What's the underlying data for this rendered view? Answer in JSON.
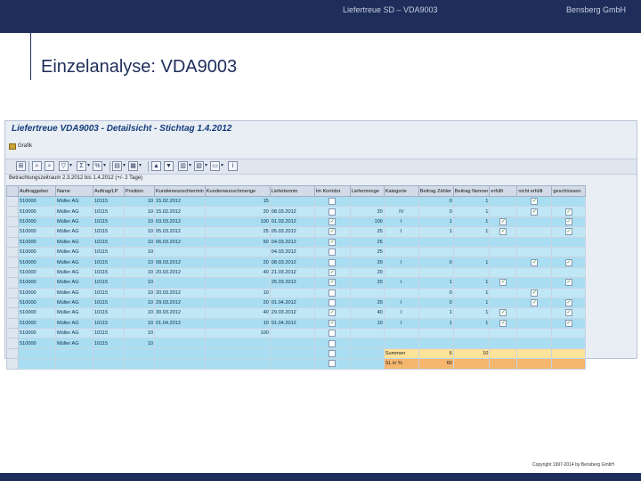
{
  "slide": {
    "header_center": "Liefertreue SD – VDA9003",
    "header_right": "Bensberg GmbH",
    "title": "Einzelanalyse: VDA9003",
    "copyright": "Copyright 1997-2014 by Bensberg GmbH"
  },
  "sap": {
    "title": "Liefertreue VDA9003 - Detailsicht - Stichtag 1.4.2012",
    "menu_button": "Grafik",
    "period_label": "Betrachtungszeitraum 2.3.2012 bis 1.4.2012 (+/- 2 Tage)",
    "toolbar_icons": [
      "details-icon",
      "find-icon",
      "filter-icon",
      "sum-icon",
      "subtotal-icon",
      "print-icon",
      "export-icon",
      "sort-asc-icon",
      "sort-desc-icon",
      "layout-icon",
      "graphic-icon",
      "info-icon"
    ],
    "columns": [
      "Auftraggeber",
      "Name",
      "Auftrag/LP",
      "Position",
      "Kundenwunschtermin",
      "Kundenwunschmenge",
      "Liefertermin",
      "Im Korridor",
      "Liefermenge",
      "Kategorie",
      "Beitrag Zähler",
      "Beitrag Nenner",
      "erfüllt",
      "nicht erfüllt",
      "geschlossen"
    ],
    "rows": [
      [
        "510000",
        "Müller AG",
        "10115",
        "10",
        "15.02.2012",
        "15",
        "",
        "",
        "",
        "",
        "0",
        "1",
        "",
        "✓",
        ""
      ],
      [
        "510000",
        "Müller AG",
        "10115",
        "10",
        "15.02.2012",
        "20",
        "08.03.2012",
        "",
        "20",
        "IV",
        "0",
        "1",
        "",
        "✓",
        "✓"
      ],
      [
        "510000",
        "Müller AG",
        "10115",
        "10",
        "03.03.2012",
        "100",
        "01.03.2012",
        "✓",
        "100",
        "I",
        "1",
        "1",
        "✓",
        "",
        "✓"
      ],
      [
        "510000",
        "Müller AG",
        "10115",
        "10",
        "05.03.2012",
        "25",
        "05.03.2012",
        "✓",
        "25",
        "I",
        "1",
        "1",
        "✓",
        "",
        "✓"
      ],
      [
        "510000",
        "Müller AG",
        "10115",
        "10",
        "06.03.2012",
        "50",
        "04.03.2012",
        "✓",
        "25",
        "",
        "",
        "",
        "",
        "",
        ""
      ],
      [
        "510000",
        "Müller AG",
        "10115",
        "10",
        "",
        "",
        "04.03.2012",
        "",
        "25",
        "",
        "",
        "",
        "",
        "",
        ""
      ],
      [
        "510000",
        "Müller AG",
        "10115",
        "10",
        "08.03.2012",
        "20",
        "08.03.2012",
        "",
        "20",
        "I",
        "0",
        "1",
        "",
        "✓",
        "✓"
      ],
      [
        "510000",
        "Müller AG",
        "10115",
        "10",
        "20.03.2012",
        "40",
        "21.03.2012",
        "✓",
        "20",
        "",
        "",
        "",
        "",
        "",
        ""
      ],
      [
        "510000",
        "Müller AG",
        "10115",
        "10",
        "",
        "",
        "25.03.2012",
        "✓",
        "20",
        "I",
        "1",
        "1",
        "✓",
        "",
        "✓"
      ],
      [
        "510000",
        "Müller AG",
        "10115",
        "10",
        "20.03.2012",
        "10",
        "",
        "",
        "",
        "",
        "0",
        "1",
        "",
        "✓",
        ""
      ],
      [
        "510000",
        "Müller AG",
        "10115",
        "10",
        "29.03.2012",
        "20",
        "01.04.2012",
        "",
        "20",
        "I",
        "0",
        "1",
        "",
        "✓",
        "✓"
      ],
      [
        "510000",
        "Müller AG",
        "10115",
        "10",
        "30.03.2012",
        "40",
        "29.03.2012",
        "✓",
        "40",
        "I",
        "1",
        "1",
        "✓",
        "",
        "✓"
      ],
      [
        "510000",
        "Müller AG",
        "10115",
        "10",
        "01.04.2012",
        "10",
        "01.04.2012",
        "✓",
        "10",
        "I",
        "1",
        "1",
        "✓",
        "",
        "✓"
      ],
      [
        "510000",
        "Müller AG",
        "10115",
        "10",
        "",
        "100",
        "",
        "",
        "",
        "",
        "",
        "",
        "",
        "",
        ""
      ],
      [
        "510000",
        "Müller AG",
        "10115",
        "10",
        "",
        "",
        "",
        "",
        "",
        "",
        "",
        "",
        "",
        "",
        ""
      ]
    ],
    "summary": {
      "sum_label": "Summen",
      "sum_counter": "6",
      "sum_denominator": "10",
      "sl_label": "SL in %",
      "sl_value": "60"
    }
  }
}
